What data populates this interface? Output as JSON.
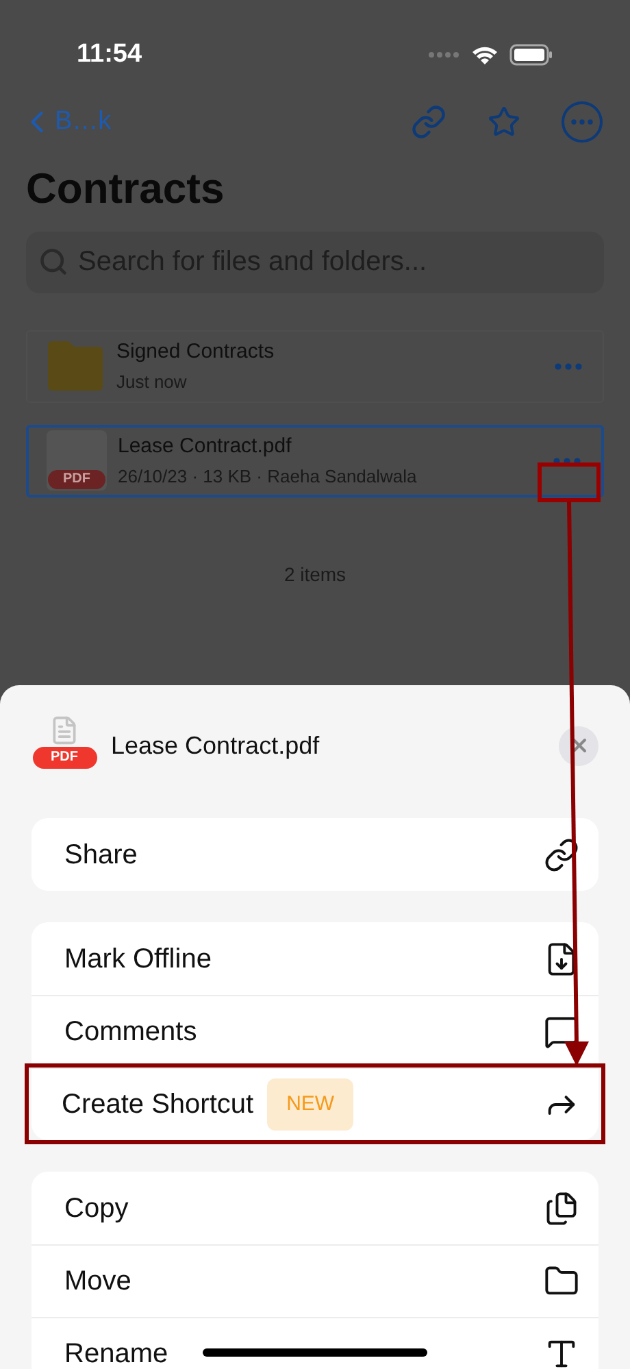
{
  "status_bar": {
    "time": "11:54"
  },
  "nav": {
    "back": "B…k"
  },
  "title": "Contracts",
  "search": {
    "placeholder": "Search for files and folders..."
  },
  "items": [
    {
      "kind": "folder",
      "name": "Signed Contracts",
      "subtitle": "Just now",
      "highlighted": false
    },
    {
      "kind": "pdf",
      "badge": "PDF",
      "name": "Lease Contract.pdf",
      "subtitle": "26/10/23 · 13 KB · Raeha Sandalwala",
      "highlighted": true
    }
  ],
  "footer": "2 items",
  "sheet": {
    "badge": "PDF",
    "file_name": "Lease Contract.pdf",
    "groups": [
      [
        {
          "label": "Share",
          "highlighted": false
        }
      ],
      [
        {
          "label": "Mark Offline",
          "highlighted": false
        },
        {
          "label": "Comments",
          "highlighted": false
        },
        {
          "label": "Create Shortcut",
          "badge": "NEW",
          "highlighted": true
        }
      ],
      [
        {
          "label": "Copy",
          "highlighted": false
        },
        {
          "label": "Move",
          "highlighted": false
        },
        {
          "label": "Rename",
          "highlighted": false
        }
      ]
    ]
  }
}
